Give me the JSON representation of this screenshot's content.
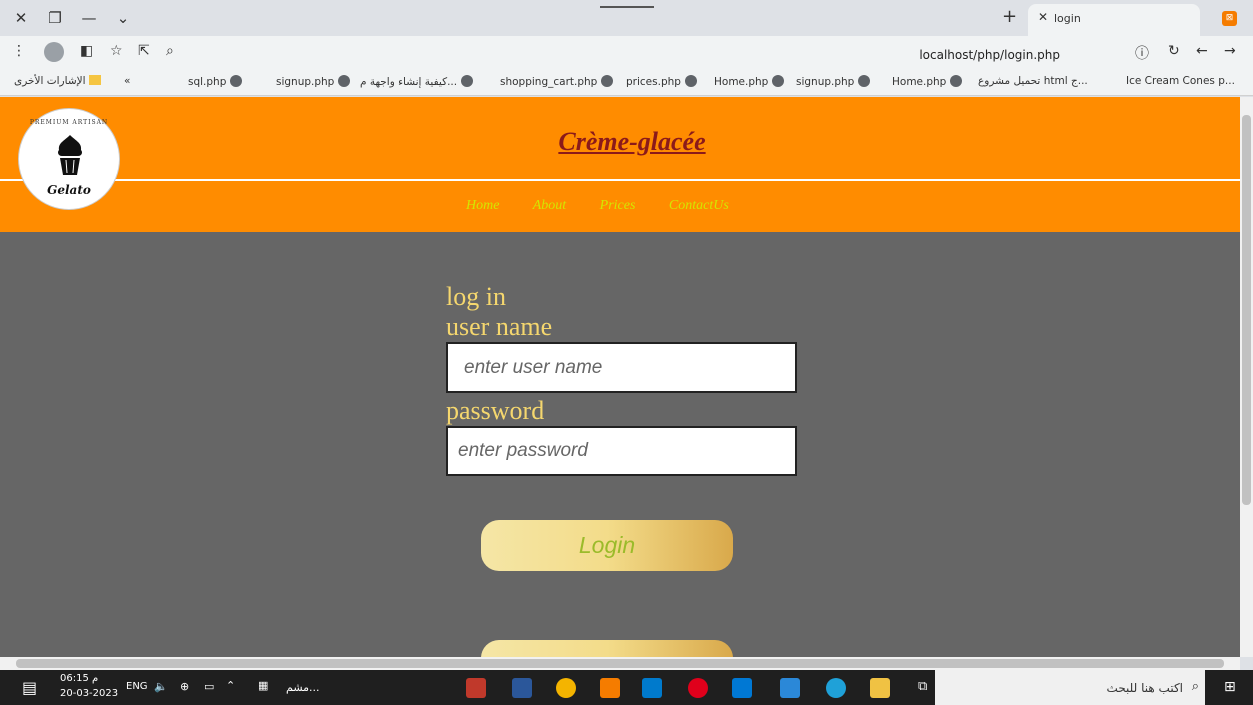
{
  "browser": {
    "tab_title": "login",
    "url": "localhost/php/login.php",
    "bookmarks": [
      "Ice Cream Cones p...",
      "تحميل مشروع html ج...",
      "Home.php",
      "signup.php",
      "Home.php",
      "prices.php",
      "shopping_cart.php",
      "كيفية إنشاء واجهة م...",
      "signup.php",
      "sql.php"
    ],
    "other_bookmarks": "الإشارات الأخرى",
    "more_bookmarks": "«"
  },
  "site": {
    "title": "Crème-glacée",
    "logo_top": "PREMIUM ARTISAN",
    "logo_word": "Gelato",
    "nav": [
      "Home",
      "About",
      "Prices",
      "ContactUs"
    ]
  },
  "form": {
    "heading": "log in",
    "username_label": "user name",
    "username_placeholder": "enter user name",
    "password_label": "password",
    "password_placeholder": "enter password",
    "login_button": "Login"
  },
  "taskbar": {
    "time": "06:15 م",
    "date": "20-03-2023",
    "lang": "ENG",
    "search_placeholder": "اكتب هنا للبحث",
    "app_label": "مشم..."
  }
}
